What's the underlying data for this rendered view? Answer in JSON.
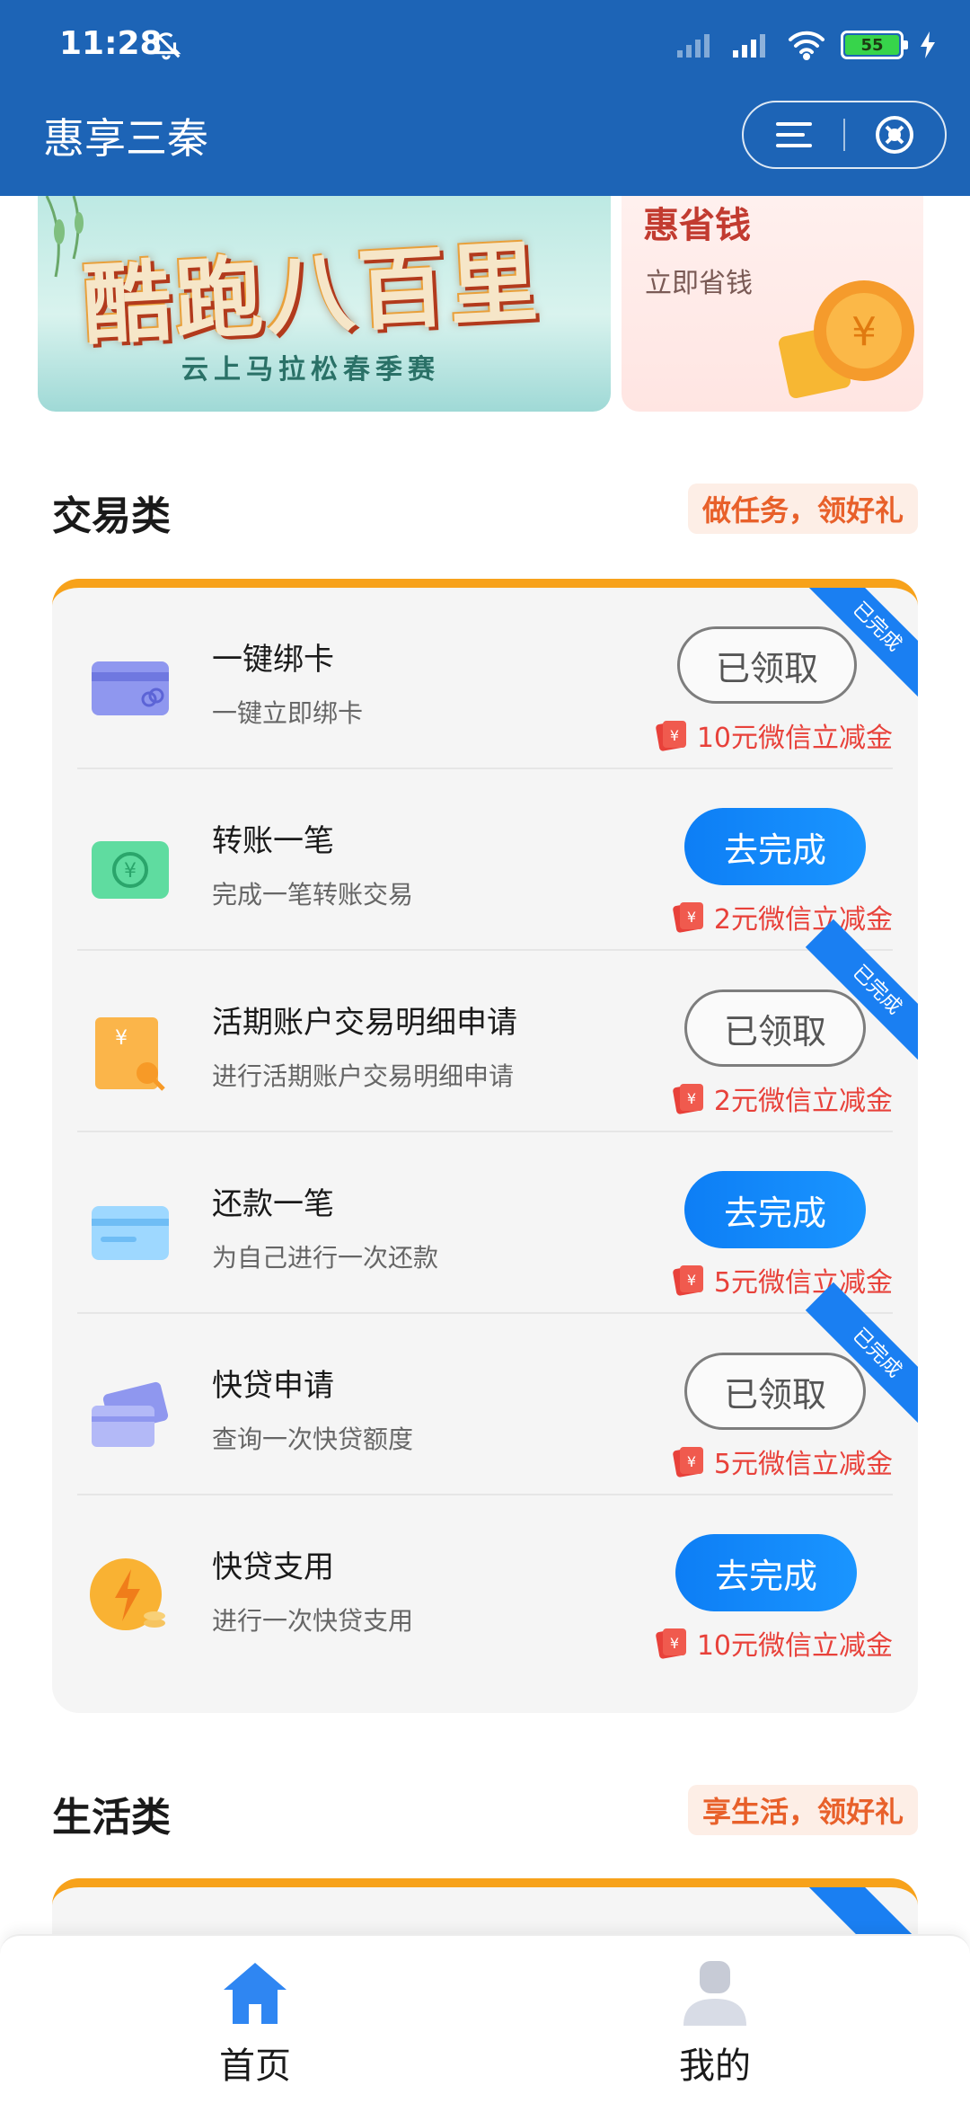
{
  "status_bar": {
    "time": "11:28",
    "battery": "55"
  },
  "nav": {
    "title": "惠享三秦"
  },
  "banners": {
    "left": {
      "title": "酷跑八百里",
      "subtitle": "云上马拉松春季赛"
    },
    "right": {
      "title": "惠省钱",
      "subtitle": "立即省钱"
    }
  },
  "sections": [
    {
      "title": "交易类",
      "tag": "做任务，领好礼",
      "tasks": [
        {
          "title": "一键绑卡",
          "desc": "一键立即绑卡",
          "button": "已领取",
          "reward": "10元微信立减金",
          "ribbon": "已完成"
        },
        {
          "title": "转账一笔",
          "desc": "完成一笔转账交易",
          "button": "去完成",
          "reward": "2元微信立减金"
        },
        {
          "title": "活期账户交易明细申请",
          "desc": "进行活期账户交易明细申请",
          "button": "已领取",
          "reward": "2元微信立减金",
          "ribbon": "已完成"
        },
        {
          "title": "还款一笔",
          "desc": "为自己进行一次还款",
          "button": "去完成",
          "reward": "5元微信立减金"
        },
        {
          "title": "快贷申请",
          "desc": "查询一次快贷额度",
          "button": "已领取",
          "reward": "5元微信立减金",
          "ribbon": "已完成"
        },
        {
          "title": "快贷支用",
          "desc": "进行一次快贷支用",
          "button": "去完成",
          "reward": "10元微信立减金"
        }
      ]
    },
    {
      "title": "生活类",
      "tag": "享生活，领好礼"
    }
  ],
  "tabbar": {
    "home": "首页",
    "mine": "我的"
  },
  "colors": {
    "header": "#1d64b6",
    "accent_blue": "#1a8af5",
    "accent_orange": "#f7a21b",
    "reward_red": "#e8413a"
  }
}
